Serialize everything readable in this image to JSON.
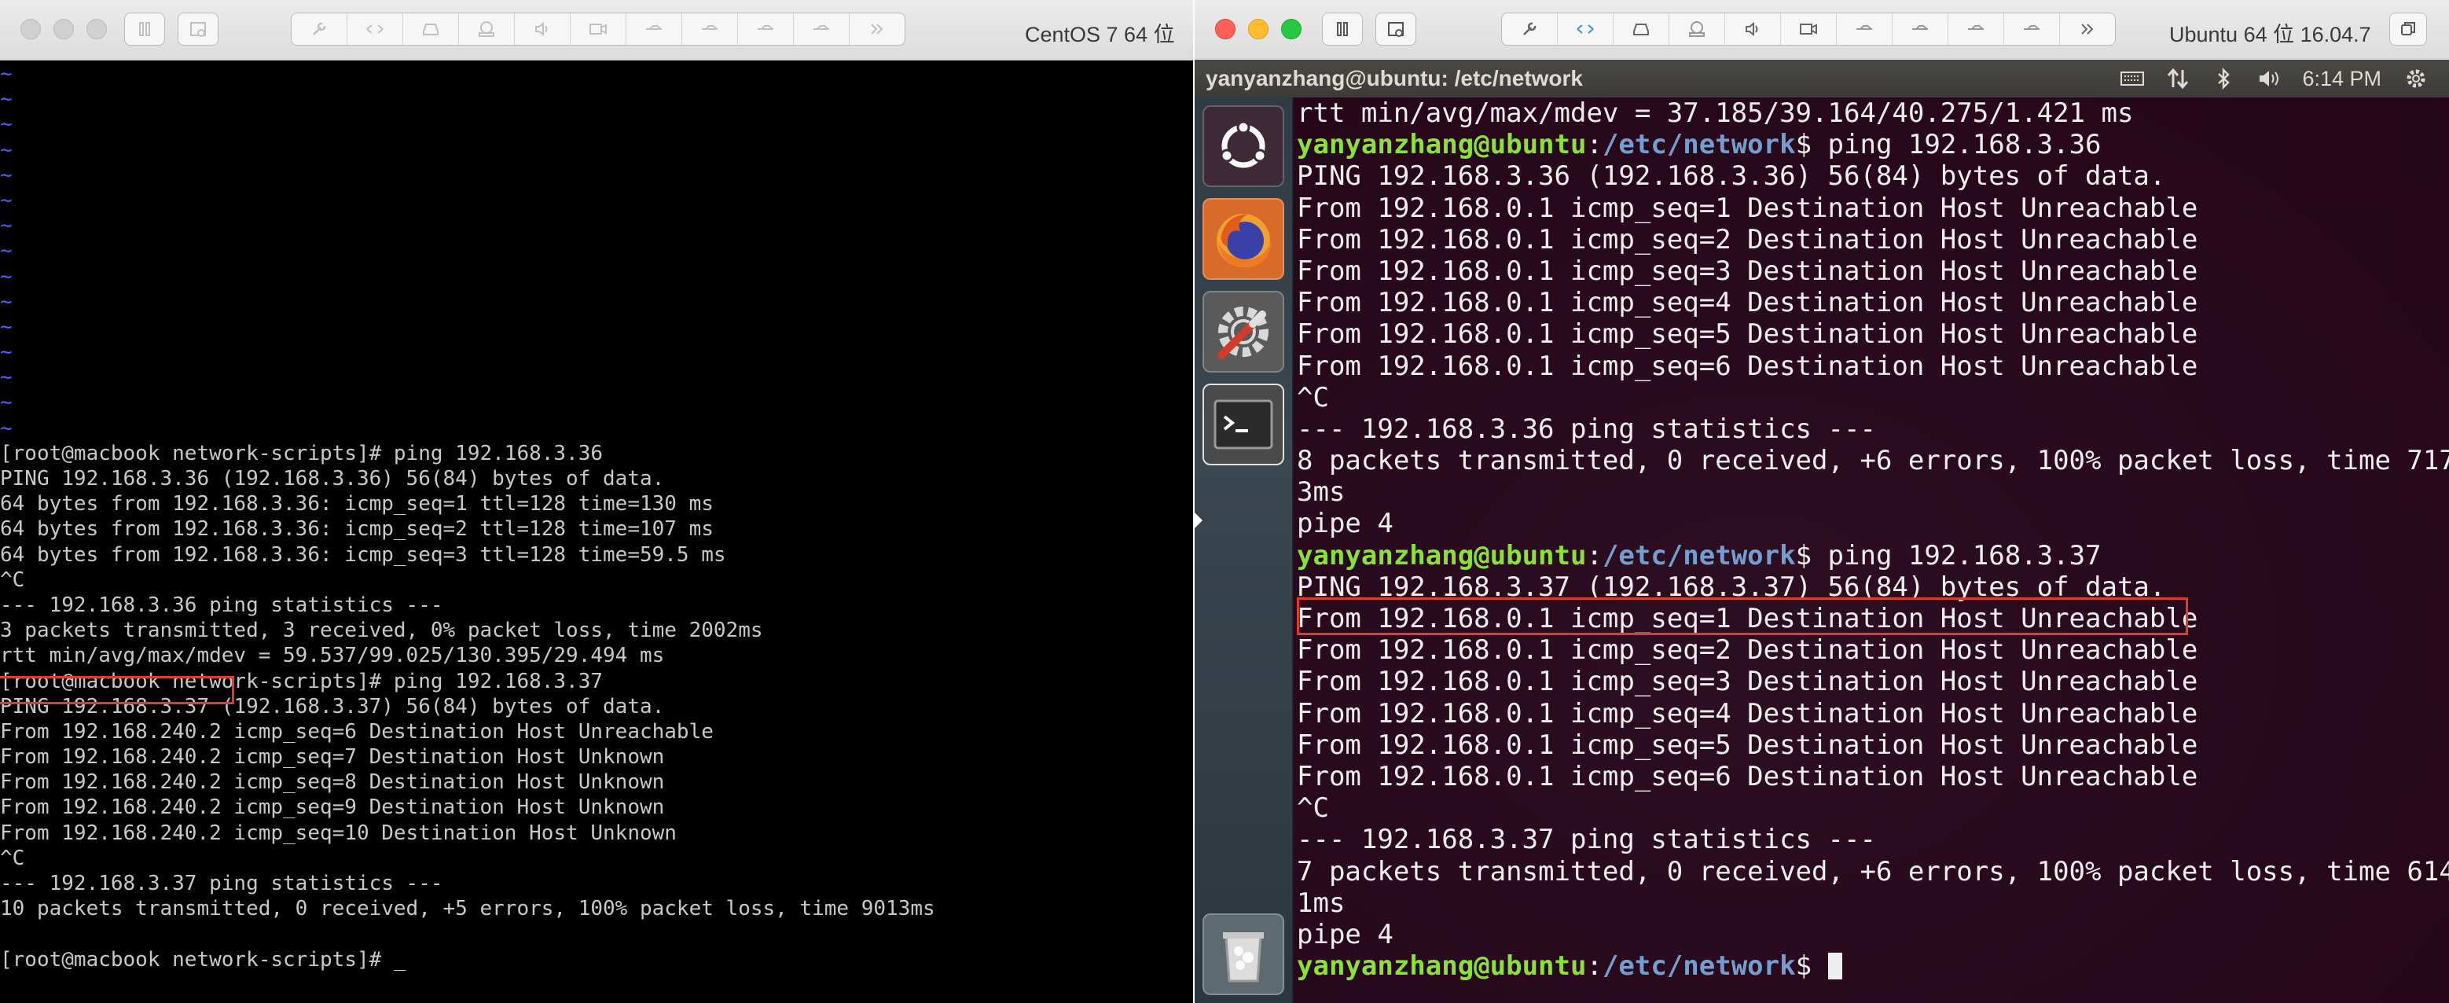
{
  "left_window": {
    "title": "CentOS 7 64 位",
    "console_tilde_rows": 15,
    "console_lines": [
      "[root@macbook network-scripts]# ping 192.168.3.36",
      "PING 192.168.3.36 (192.168.3.36) 56(84) bytes of data.",
      "64 bytes from 192.168.3.36: icmp_seq=1 ttl=128 time=130 ms",
      "64 bytes from 192.168.3.36: icmp_seq=2 ttl=128 time=107 ms",
      "64 bytes from 192.168.3.36: icmp_seq=3 ttl=128 time=59.5 ms",
      "^C",
      "--- 192.168.3.36 ping statistics ---",
      "3 packets transmitted, 3 received, 0% packet loss, time 2002ms",
      "rtt min/avg/max/mdev = 59.537/99.025/130.395/29.494 ms",
      "[root@macbook network-scripts]# ping 192.168.3.37",
      "PING 192.168.3.37 (192.168.3.37) 56(84) bytes of data.",
      "From 192.168.240.2 icmp_seq=6 Destination Host Unreachable",
      "From 192.168.240.2 icmp_seq=7 Destination Host Unknown",
      "From 192.168.240.2 icmp_seq=8 Destination Host Unknown",
      "From 192.168.240.2 icmp_seq=9 Destination Host Unknown",
      "From 192.168.240.2 icmp_seq=10 Destination Host Unknown",
      "^C",
      "--- 192.168.3.37 ping statistics ---",
      "10 packets transmitted, 0 received, +5 errors, 100% packet loss, time 9013ms",
      "",
      "[root@macbook network-scripts]# _"
    ],
    "highlight_color": "#e23a2c"
  },
  "right_window": {
    "title": "Ubuntu 64 位 16.04.7",
    "ubuntu_bar_title": "yanyanzhang@ubuntu: /etc/network",
    "clock": "6:14 PM",
    "launcher_items": [
      "ubuntu-dash-icon",
      "firefox-icon",
      "system-settings-icon",
      "terminal-icon",
      "trash-icon"
    ],
    "terminal_colors": {
      "user": "#8ae234",
      "path": "#729fcf",
      "text": "#eeeeec",
      "background": "#2c0a1e"
    },
    "prompt": {
      "user_host": "yanyanzhang@ubuntu",
      "path": "/etc/network"
    },
    "terminal_lines": [
      {
        "text": "rtt min/avg/max/mdev = 37.185/39.164/40.275/1.421 ms"
      },
      {
        "prompt": true,
        "cmd": " ping 192.168.3.36"
      },
      {
        "text": "PING 192.168.3.36 (192.168.3.36) 56(84) bytes of data."
      },
      {
        "text": "From 192.168.0.1 icmp_seq=1 Destination Host Unreachable"
      },
      {
        "text": "From 192.168.0.1 icmp_seq=2 Destination Host Unreachable"
      },
      {
        "text": "From 192.168.0.1 icmp_seq=3 Destination Host Unreachable"
      },
      {
        "text": "From 192.168.0.1 icmp_seq=4 Destination Host Unreachable"
      },
      {
        "text": "From 192.168.0.1 icmp_seq=5 Destination Host Unreachable"
      },
      {
        "text": "From 192.168.0.1 icmp_seq=6 Destination Host Unreachable"
      },
      {
        "text": "^C"
      },
      {
        "text": "--- 192.168.3.36 ping statistics ---"
      },
      {
        "text": "8 packets transmitted, 0 received, +6 errors, 100% packet loss, time 717"
      },
      {
        "text": "3ms"
      },
      {
        "text": "pipe 4"
      },
      {
        "prompt": true,
        "cmd": " ping 192.168.3.37"
      },
      {
        "text": "PING 192.168.3.37 (192.168.3.37) 56(84) bytes of data."
      },
      {
        "text": "From 192.168.0.1 icmp_seq=1 Destination Host Unreachable"
      },
      {
        "text": "From 192.168.0.1 icmp_seq=2 Destination Host Unreachable"
      },
      {
        "text": "From 192.168.0.1 icmp_seq=3 Destination Host Unreachable"
      },
      {
        "text": "From 192.168.0.1 icmp_seq=4 Destination Host Unreachable"
      },
      {
        "text": "From 192.168.0.1 icmp_seq=5 Destination Host Unreachable"
      },
      {
        "text": "From 192.168.0.1 icmp_seq=6 Destination Host Unreachable"
      },
      {
        "text": "^C"
      },
      {
        "text": "--- 192.168.3.37 ping statistics ---"
      },
      {
        "text": "7 packets transmitted, 0 received, +6 errors, 100% packet loss, time 614"
      },
      {
        "text": "1ms"
      },
      {
        "text": "pipe 4"
      },
      {
        "prompt": true,
        "cmd": " ",
        "cursor": true
      }
    ]
  }
}
